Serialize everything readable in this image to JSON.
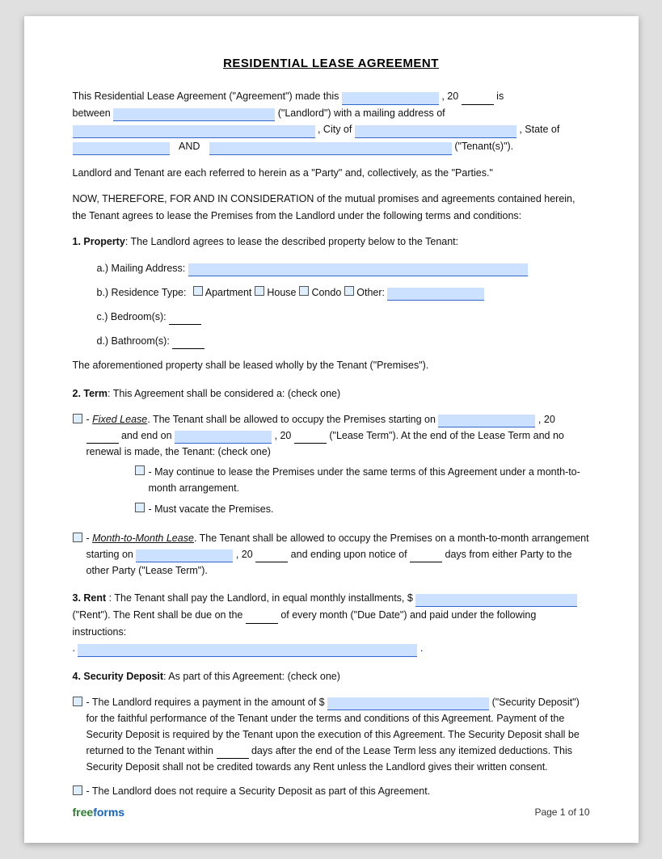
{
  "title": "RESIDENTIAL LEASE AGREEMENT",
  "intro": {
    "line1_pre": "This Residential Lease Agreement (\"Agreement\") made this",
    "line1_mid": ", 20",
    "line1_post": " is",
    "line2_pre": "between",
    "line2_mid": "(\"Landlord\") with a mailing address of",
    "line3_mid": ", City of",
    "line3_post": ", State of",
    "line4_pre": "",
    "line4_and": "AND",
    "line4_post": "(\"Tenant(s)\")."
  },
  "parties_text": "Landlord and Tenant are each referred to herein as a \"Party\" and, collectively, as the \"Parties.\"",
  "now_text": "NOW, THEREFORE, FOR AND IN CONSIDERATION of the mutual promises and agreements contained herein, the Tenant agrees to lease the Premises from the Landlord under the following terms and conditions:",
  "section1": {
    "label": "1. Property",
    "text": ": The Landlord agrees to lease the described property below to the Tenant:",
    "items": [
      {
        "label": "a.) Mailing Address:",
        "type": "field_full"
      },
      {
        "label": "b.) Residence Type:",
        "type": "checkboxes",
        "options": [
          "Apartment",
          "House",
          "Condo",
          "Other:"
        ]
      },
      {
        "label": "c.) Bedroom(s):",
        "type": "field_sm"
      },
      {
        "label": "d.) Bathroom(s):",
        "type": "field_sm"
      }
    ],
    "closing": "The aforementioned property shall be leased wholly by the Tenant (\"Premises\")."
  },
  "section2": {
    "label": "2. Term",
    "text": ": This Agreement shall be considered a: (check one)",
    "fixed_lease": {
      "label": "Fixed Lease",
      "text1": ". The Tenant shall be allowed to occupy the Premises starting on",
      "text2": ", 20",
      "text3": " and end on",
      "text4": ", 20",
      "text5": " (\"Lease Term\"). At the end of the Lease Term and no renewal is made, the Tenant: (check one)",
      "option1": "- May continue to lease the Premises under the same terms of this Agreement under a month-to-month arrangement.",
      "option2": "- Must vacate the Premises."
    },
    "month_lease": {
      "label": "Month-to-Month Lease",
      "text1": ". The Tenant shall be allowed to occupy the Premises on a month-to-month arrangement starting on",
      "text2": ", 20",
      "text3": " and ending upon notice of",
      "text4": " days from either Party to the other Party (\"Lease Term\")."
    }
  },
  "section3": {
    "label": "3. Rent",
    "text1": ": The Tenant shall pay the Landlord, in equal monthly installments, $",
    "text2": "(\"Rent\"). The Rent shall be due on the",
    "text3": " of every month (\"Due Date\") and paid under the following instructions:",
    "text4": "."
  },
  "section4": {
    "label": "4. Security Deposit",
    "text": ": As part of this Agreement: (check one)",
    "option1_pre": "- The Landlord requires a payment in the amount of $",
    "option1_post": "(\"Security Deposit\") for the faithful performance of the Tenant under the terms and conditions of this Agreement. Payment of the Security Deposit is required by the Tenant upon the execution of this Agreement. The Security Deposit shall be returned to the Tenant within",
    "option1_mid": " days after the end of the Lease Term less any itemized deductions. This Security Deposit shall not be credited towards any Rent unless the Landlord gives their written consent.",
    "option2": "- The Landlord does not require a Security Deposit as part of this Agreement."
  },
  "footer": {
    "logo_free": "free",
    "logo_forms": "forms",
    "page_label": "Page 1 of 10"
  }
}
